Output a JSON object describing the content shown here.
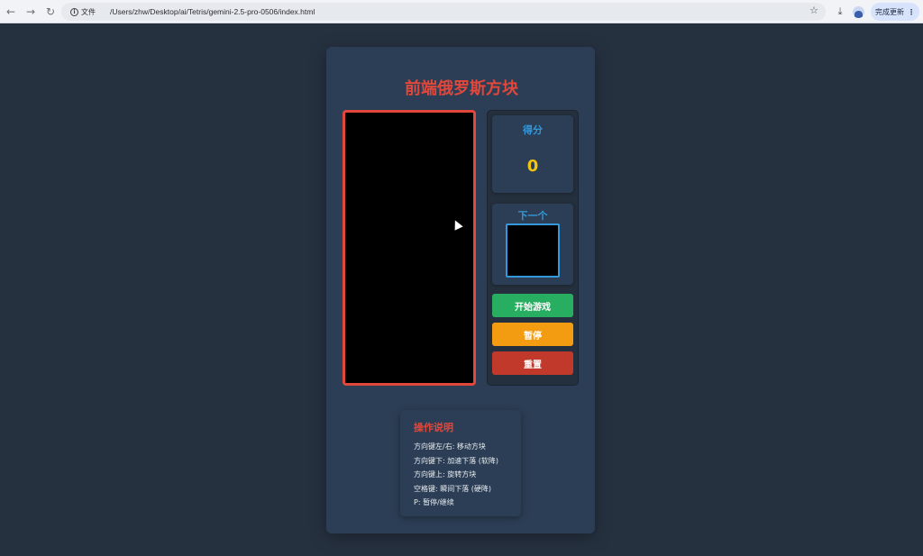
{
  "browser": {
    "site_label": "文件",
    "url": "/Users/zhw/Desktop/ai/Tetris/gemini-2.5-pro-0506/index.html",
    "update_label": "完成更新",
    "icons": [
      "back-arrow-icon",
      "forward-arrow-icon",
      "reload-icon",
      "info-icon",
      "star-icon",
      "download-icon",
      "profile-avatar-icon",
      "menu-dots-icon"
    ]
  },
  "game": {
    "title": "前端俄罗斯方块",
    "score_label": "得分",
    "score_value": "0",
    "next_label": "下一个",
    "start_label": "开始游戏",
    "pause_label": "暂停",
    "reset_label": "重置"
  },
  "instructions": {
    "title": "操作说明",
    "items": [
      "方向键左/右: 移动方块",
      "方向键下: 加速下落 (软降)",
      "方向键上: 旋转方块",
      "空格键: 瞬间下落 (硬降)",
      "P: 暂停/继续"
    ]
  },
  "colors": {
    "page_bg": "#263140",
    "container_bg": "#2c3e55",
    "title_red": "#e2473b",
    "accent_blue": "#3498db",
    "score_yellow": "#f1c40f",
    "start_green": "#27ae60",
    "pause_orange": "#f39c12",
    "reset_red": "#c0392b"
  }
}
